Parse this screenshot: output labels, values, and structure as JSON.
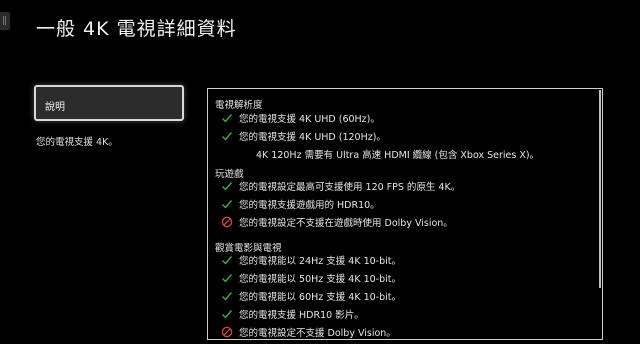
{
  "title": "一般  4K 電視詳細資料",
  "menu": {
    "button_label": "說明",
    "description": "您的電視支援 4K。"
  },
  "colors": {
    "check": "#3fae3f",
    "error": "#d9483b",
    "border": "#cfcfcf"
  },
  "sections": [
    {
      "heading": "電視解析度",
      "items": [
        {
          "status": "check-icon",
          "text": "您的電視支援 4K UHD (60Hz)。"
        },
        {
          "status": "check-icon",
          "text": "您的電視支援 4K UHD (120Hz)。"
        }
      ],
      "note": "4K 120Hz 需要有 Ultra 高速 HDMI 纜線 (包含 Xbox Series X)。"
    },
    {
      "heading": "玩遊戲",
      "items": [
        {
          "status": "check-icon",
          "text": "您的電視設定最高可支援使用 120 FPS 的原生 4K。"
        },
        {
          "status": "check-icon",
          "text": "您的電視支援遊戲用的 HDR10。"
        },
        {
          "status": "blocked-icon",
          "text": "您的電視設定不支援在遊戲時使用 Dolby Vision。"
        }
      ]
    },
    {
      "heading": "觀賞電影與電視",
      "items": [
        {
          "status": "check-icon",
          "text": "您的電視能以 24Hz 支援 4K 10-bit。"
        },
        {
          "status": "check-icon",
          "text": "您的電視能以 50Hz 支援 4K 10-bit。"
        },
        {
          "status": "check-icon",
          "text": "您的電視能以 60Hz 支援 4K 10-bit。"
        },
        {
          "status": "check-icon",
          "text": "您的電視支援 HDR10 影片。"
        },
        {
          "status": "blocked-icon",
          "text": "您的電視設定不支援 Dolby Vision。"
        }
      ]
    }
  ]
}
